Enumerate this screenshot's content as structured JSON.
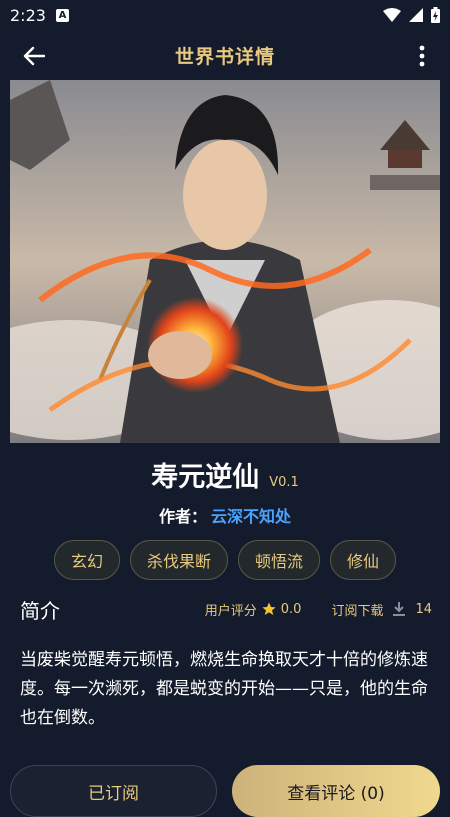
{
  "status_bar": {
    "time": "2:23",
    "app_icon": "A"
  },
  "header": {
    "title": "世界书详情"
  },
  "book": {
    "title": "寿元逆仙",
    "version": "V0.1",
    "author_label": "作者：",
    "author_name": "云深不知处",
    "tags": [
      "玄幻",
      "杀伐果断",
      "顿悟流",
      "修仙"
    ]
  },
  "intro": {
    "heading": "简介",
    "rating_label": "用户评分",
    "rating_value": "0.0",
    "downloads_label": "订阅下载",
    "downloads_value": "14",
    "description": "当废柴觉醒寿元顿悟，燃烧生命换取天才十倍的修炼速度。每一次濒死，都是蜕变的开始——只是，他的生命也在倒数。"
  },
  "actions": {
    "subscribed_label": "已订阅",
    "comments_label": "查看评论 (0)"
  },
  "colors": {
    "background": "#141b2c",
    "accent_gold": "#e8c97e",
    "author_blue": "#4aa3ff"
  }
}
